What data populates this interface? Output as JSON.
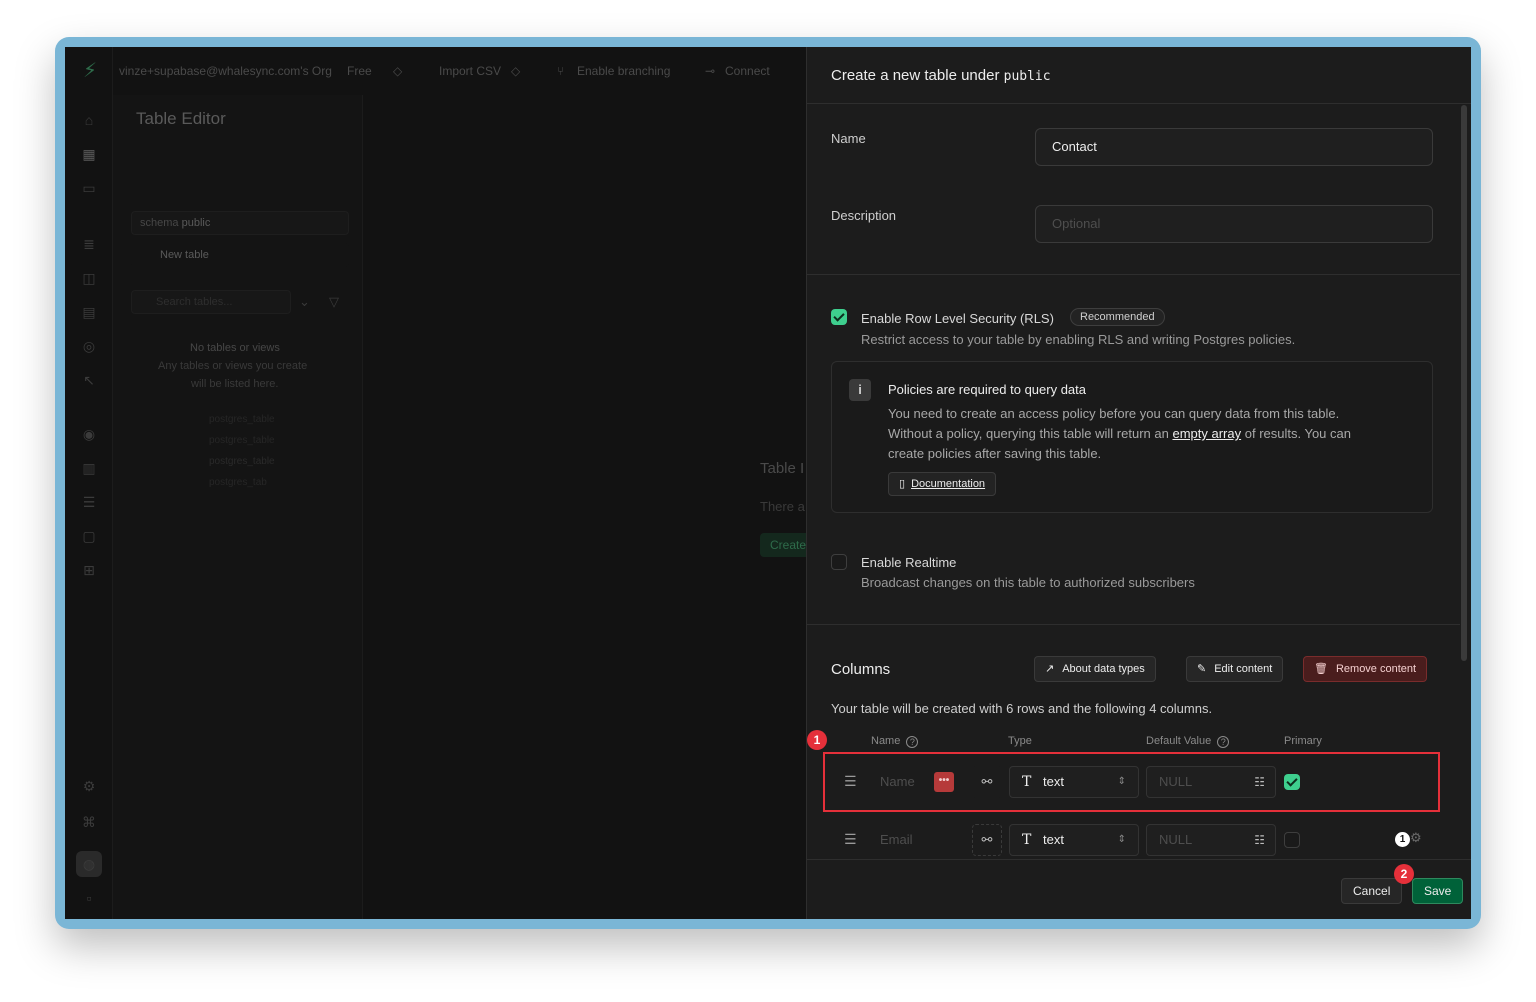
{
  "app": {
    "org": "vinze+supabase@whalesync.com's Org",
    "plan": "Free",
    "import_csv": "Import CSV",
    "enable_branching": "Enable branching",
    "connect": "Connect"
  },
  "sidebar": {
    "title": "Table Editor",
    "schema_label": "schema",
    "schema_value": "public",
    "new_table": "New table",
    "search_placeholder": "Search tables...",
    "empty_title": "No tables or views",
    "empty_desc_1": "Any tables or views you create",
    "empty_desc_2": "will be listed here.",
    "ghost_items": [
      "postgres_table",
      "postgres_table",
      "postgres_table",
      "postgres_tab"
    ]
  },
  "background": {
    "title": "Table I",
    "desc": "There a",
    "create": "Create"
  },
  "panel": {
    "title_prefix": "Create a new table under",
    "schema": "public",
    "name_label": "Name",
    "name_value": "Contact",
    "description_label": "Description",
    "description_placeholder": "Optional",
    "rls": {
      "label": "Enable Row Level Security (RLS)",
      "badge": "Recommended",
      "desc": "Restrict access to your table by enabling RLS and writing Postgres policies."
    },
    "notice": {
      "title": "Policies are required to query data",
      "line1": "You need to create an access policy before you can query data from this table.",
      "line2_pre": "Without a policy, querying this table will return an",
      "line2_link": "empty array",
      "line2_post": "of results. You can",
      "line3": "create policies after saving this table.",
      "doc_button": "Documentation"
    },
    "realtime": {
      "label": "Enable Realtime",
      "desc": "Broadcast changes on this table to authorized subscribers"
    },
    "columns": {
      "title": "Columns",
      "about_button": "About data types",
      "edit_button": "Edit content",
      "remove_button": "Remove content",
      "summary": "Your table will be created with 6 rows and the following 4 columns.",
      "headers": {
        "name": "Name",
        "type": "Type",
        "default": "Default Value",
        "primary": "Primary"
      },
      "rows": [
        {
          "name_placeholder": "Name",
          "type": "text",
          "default_placeholder": "NULL",
          "primary": true
        },
        {
          "name_placeholder": "Email",
          "type": "text",
          "default_placeholder": "NULL",
          "primary": false,
          "count": "1"
        }
      ]
    },
    "footer": {
      "cancel": "Cancel",
      "save": "Save"
    }
  },
  "markers": {
    "m1": "1",
    "m2": "2"
  },
  "colors": {
    "accent": "#3ecf8e",
    "danger": "#e5303a",
    "save": "#006239"
  }
}
